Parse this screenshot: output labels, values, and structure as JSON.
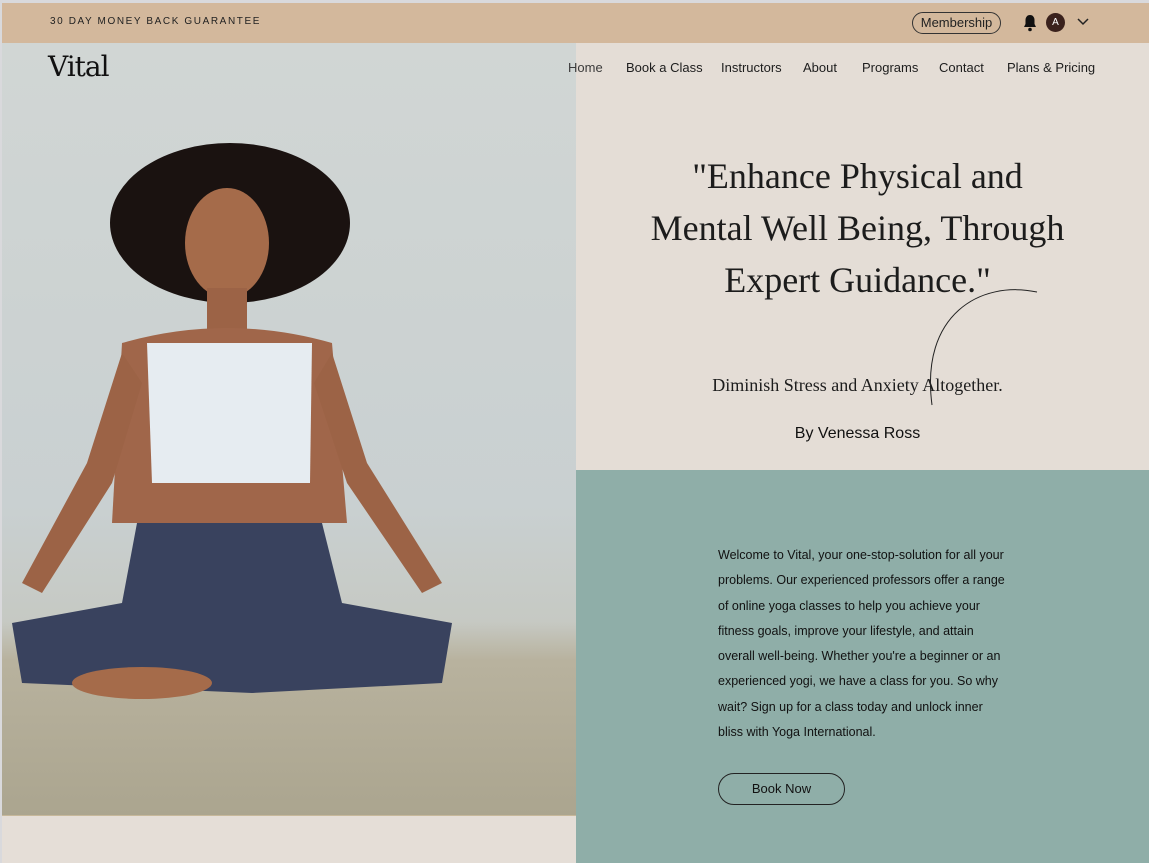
{
  "topbar": {
    "promo": "30 DAY MONEY BACK GUARANTEE",
    "membership": "Membership",
    "avatar_initial": "A"
  },
  "header": {
    "logo": "Vital",
    "nav": [
      "Home",
      "Book a Class",
      "Instructors",
      "About",
      "Programs",
      "Contact",
      "Plans & Pricing"
    ]
  },
  "hero": {
    "quote": "\"Enhance Physical and Mental Well Being, Through Expert Guidance.\"",
    "subtitle": "Diminish Stress and Anxiety Altogether.",
    "author": "By Venessa Ross"
  },
  "intro": {
    "text": "Welcome to Vital, your one-stop-solution for all your problems. Our experienced professors offer a range of online yoga classes to help you achieve your fitness goals, improve your lifestyle, and attain overall well-being. Whether you're a beginner or an experienced yogi, we have a class for you. So why wait? Sign up for a class today and unlock inner bliss with Yoga International.",
    "button": "Book Now"
  },
  "colors": {
    "topbar": "#d3b89c",
    "hero": "#e4ddd6",
    "teal": "#8faea8"
  }
}
